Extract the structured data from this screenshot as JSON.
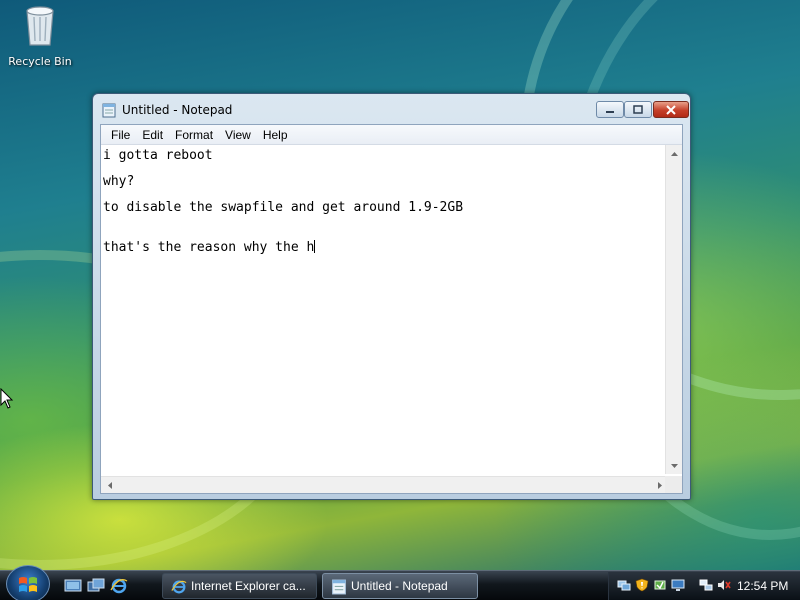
{
  "desktop": {
    "icons": [
      {
        "label": "Recycle Bin",
        "icon": "recycle-bin-icon"
      }
    ]
  },
  "window": {
    "title": "Untitled - Notepad",
    "icon": "notepad-icon",
    "menu": [
      "File",
      "Edit",
      "Format",
      "View",
      "Help"
    ],
    "lines": [
      "i gotta reboot",
      "",
      "why?",
      "",
      "to disable the swapfile and get around 1.9-2GB",
      "",
      "",
      "that's the reason why the h"
    ]
  },
  "taskbar": {
    "quick_launch": [
      "show-desktop-icon",
      "switch-windows-icon",
      "internet-explorer-icon"
    ],
    "tasks": [
      {
        "label": "Internet Explorer ca...",
        "icon": "internet-explorer-icon",
        "active": false
      },
      {
        "label": "Untitled - Notepad",
        "icon": "notepad-icon",
        "active": true
      }
    ],
    "tray_icons": [
      "network-icon",
      "security-shield-icon",
      "safely-remove-icon",
      "monitor-icon",
      "volume-muted-icon"
    ],
    "clock": "12:54 PM"
  },
  "colors": {
    "window_frame": "#b9cde0",
    "close_button": "#c6402a",
    "taskbar": "#11171d"
  }
}
